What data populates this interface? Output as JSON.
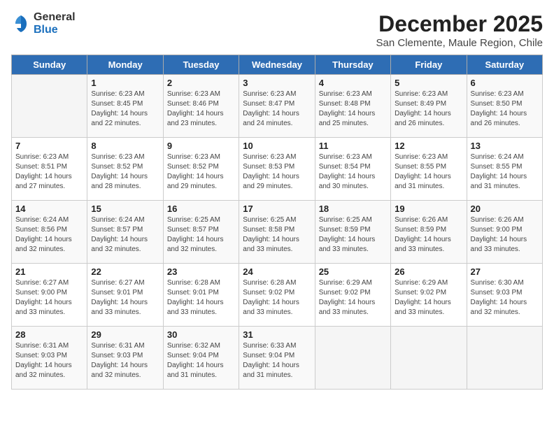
{
  "header": {
    "logo_general": "General",
    "logo_blue": "Blue",
    "month_year": "December 2025",
    "location": "San Clemente, Maule Region, Chile"
  },
  "days_of_week": [
    "Sunday",
    "Monday",
    "Tuesday",
    "Wednesday",
    "Thursday",
    "Friday",
    "Saturday"
  ],
  "weeks": [
    [
      {
        "day": "",
        "empty": true
      },
      {
        "day": "1",
        "sunrise": "Sunrise: 6:23 AM",
        "sunset": "Sunset: 8:45 PM",
        "daylight": "Daylight: 14 hours and 22 minutes."
      },
      {
        "day": "2",
        "sunrise": "Sunrise: 6:23 AM",
        "sunset": "Sunset: 8:46 PM",
        "daylight": "Daylight: 14 hours and 23 minutes."
      },
      {
        "day": "3",
        "sunrise": "Sunrise: 6:23 AM",
        "sunset": "Sunset: 8:47 PM",
        "daylight": "Daylight: 14 hours and 24 minutes."
      },
      {
        "day": "4",
        "sunrise": "Sunrise: 6:23 AM",
        "sunset": "Sunset: 8:48 PM",
        "daylight": "Daylight: 14 hours and 25 minutes."
      },
      {
        "day": "5",
        "sunrise": "Sunrise: 6:23 AM",
        "sunset": "Sunset: 8:49 PM",
        "daylight": "Daylight: 14 hours and 26 minutes."
      },
      {
        "day": "6",
        "sunrise": "Sunrise: 6:23 AM",
        "sunset": "Sunset: 8:50 PM",
        "daylight": "Daylight: 14 hours and 26 minutes."
      }
    ],
    [
      {
        "day": "7",
        "sunrise": "Sunrise: 6:23 AM",
        "sunset": "Sunset: 8:51 PM",
        "daylight": "Daylight: 14 hours and 27 minutes."
      },
      {
        "day": "8",
        "sunrise": "Sunrise: 6:23 AM",
        "sunset": "Sunset: 8:52 PM",
        "daylight": "Daylight: 14 hours and 28 minutes."
      },
      {
        "day": "9",
        "sunrise": "Sunrise: 6:23 AM",
        "sunset": "Sunset: 8:52 PM",
        "daylight": "Daylight: 14 hours and 29 minutes."
      },
      {
        "day": "10",
        "sunrise": "Sunrise: 6:23 AM",
        "sunset": "Sunset: 8:53 PM",
        "daylight": "Daylight: 14 hours and 29 minutes."
      },
      {
        "day": "11",
        "sunrise": "Sunrise: 6:23 AM",
        "sunset": "Sunset: 8:54 PM",
        "daylight": "Daylight: 14 hours and 30 minutes."
      },
      {
        "day": "12",
        "sunrise": "Sunrise: 6:23 AM",
        "sunset": "Sunset: 8:55 PM",
        "daylight": "Daylight: 14 hours and 31 minutes."
      },
      {
        "day": "13",
        "sunrise": "Sunrise: 6:24 AM",
        "sunset": "Sunset: 8:55 PM",
        "daylight": "Daylight: 14 hours and 31 minutes."
      }
    ],
    [
      {
        "day": "14",
        "sunrise": "Sunrise: 6:24 AM",
        "sunset": "Sunset: 8:56 PM",
        "daylight": "Daylight: 14 hours and 32 minutes."
      },
      {
        "day": "15",
        "sunrise": "Sunrise: 6:24 AM",
        "sunset": "Sunset: 8:57 PM",
        "daylight": "Daylight: 14 hours and 32 minutes."
      },
      {
        "day": "16",
        "sunrise": "Sunrise: 6:25 AM",
        "sunset": "Sunset: 8:57 PM",
        "daylight": "Daylight: 14 hours and 32 minutes."
      },
      {
        "day": "17",
        "sunrise": "Sunrise: 6:25 AM",
        "sunset": "Sunset: 8:58 PM",
        "daylight": "Daylight: 14 hours and 33 minutes."
      },
      {
        "day": "18",
        "sunrise": "Sunrise: 6:25 AM",
        "sunset": "Sunset: 8:59 PM",
        "daylight": "Daylight: 14 hours and 33 minutes."
      },
      {
        "day": "19",
        "sunrise": "Sunrise: 6:26 AM",
        "sunset": "Sunset: 8:59 PM",
        "daylight": "Daylight: 14 hours and 33 minutes."
      },
      {
        "day": "20",
        "sunrise": "Sunrise: 6:26 AM",
        "sunset": "Sunset: 9:00 PM",
        "daylight": "Daylight: 14 hours and 33 minutes."
      }
    ],
    [
      {
        "day": "21",
        "sunrise": "Sunrise: 6:27 AM",
        "sunset": "Sunset: 9:00 PM",
        "daylight": "Daylight: 14 hours and 33 minutes."
      },
      {
        "day": "22",
        "sunrise": "Sunrise: 6:27 AM",
        "sunset": "Sunset: 9:01 PM",
        "daylight": "Daylight: 14 hours and 33 minutes."
      },
      {
        "day": "23",
        "sunrise": "Sunrise: 6:28 AM",
        "sunset": "Sunset: 9:01 PM",
        "daylight": "Daylight: 14 hours and 33 minutes."
      },
      {
        "day": "24",
        "sunrise": "Sunrise: 6:28 AM",
        "sunset": "Sunset: 9:02 PM",
        "daylight": "Daylight: 14 hours and 33 minutes."
      },
      {
        "day": "25",
        "sunrise": "Sunrise: 6:29 AM",
        "sunset": "Sunset: 9:02 PM",
        "daylight": "Daylight: 14 hours and 33 minutes."
      },
      {
        "day": "26",
        "sunrise": "Sunrise: 6:29 AM",
        "sunset": "Sunset: 9:02 PM",
        "daylight": "Daylight: 14 hours and 33 minutes."
      },
      {
        "day": "27",
        "sunrise": "Sunrise: 6:30 AM",
        "sunset": "Sunset: 9:03 PM",
        "daylight": "Daylight: 14 hours and 32 minutes."
      }
    ],
    [
      {
        "day": "28",
        "sunrise": "Sunrise: 6:31 AM",
        "sunset": "Sunset: 9:03 PM",
        "daylight": "Daylight: 14 hours and 32 minutes."
      },
      {
        "day": "29",
        "sunrise": "Sunrise: 6:31 AM",
        "sunset": "Sunset: 9:03 PM",
        "daylight": "Daylight: 14 hours and 32 minutes."
      },
      {
        "day": "30",
        "sunrise": "Sunrise: 6:32 AM",
        "sunset": "Sunset: 9:04 PM",
        "daylight": "Daylight: 14 hours and 31 minutes."
      },
      {
        "day": "31",
        "sunrise": "Sunrise: 6:33 AM",
        "sunset": "Sunset: 9:04 PM",
        "daylight": "Daylight: 14 hours and 31 minutes."
      },
      {
        "day": "",
        "empty": true
      },
      {
        "day": "",
        "empty": true
      },
      {
        "day": "",
        "empty": true
      }
    ]
  ]
}
